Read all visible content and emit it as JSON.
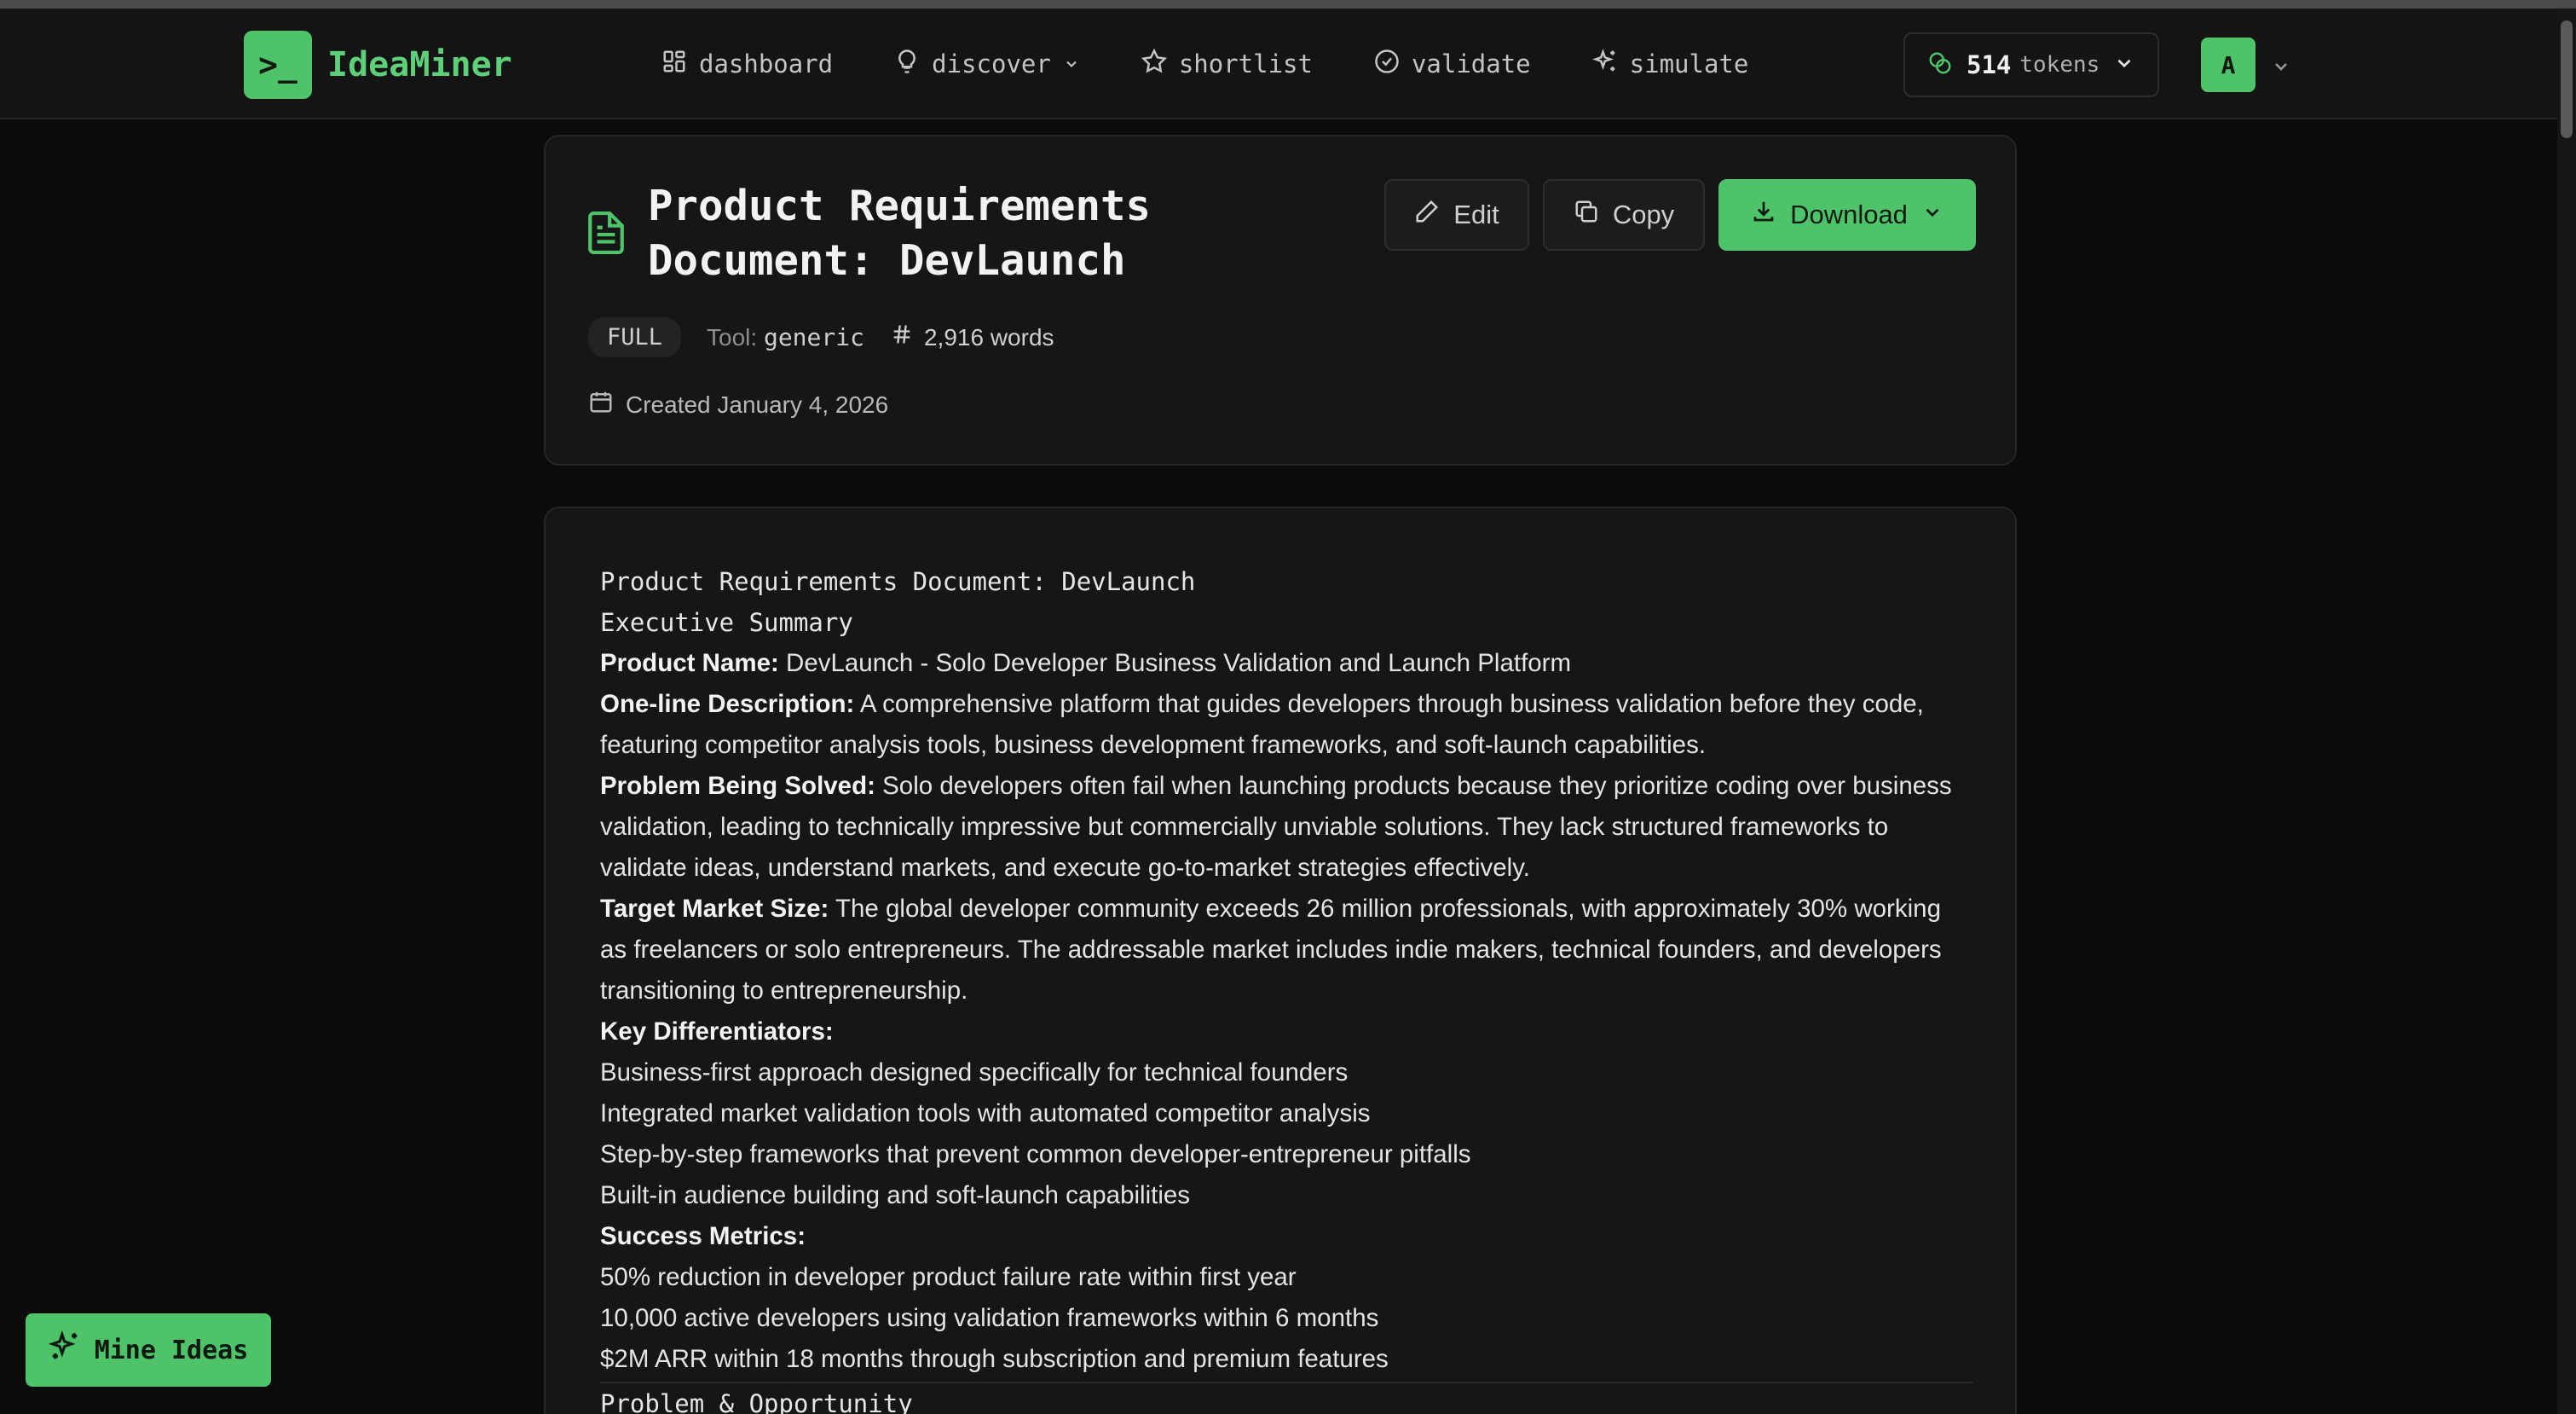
{
  "app": {
    "name": "IdeaMiner",
    "logo_glyph": ">_",
    "accent": "#4fc36a"
  },
  "nav": {
    "items": [
      {
        "label": "dashboard",
        "icon": "grid-icon"
      },
      {
        "label": "discover",
        "icon": "lightbulb-icon",
        "dropdown": true
      },
      {
        "label": "shortlist",
        "icon": "star-icon"
      },
      {
        "label": "validate",
        "icon": "check-circle-icon"
      },
      {
        "label": "simulate",
        "icon": "sparkles-icon"
      }
    ]
  },
  "tokens": {
    "count": "514",
    "label": "tokens"
  },
  "user": {
    "avatar_initial": "A"
  },
  "document": {
    "title": "Product Requirements Document: DevLaunch",
    "badge": "FULL",
    "tool_label": "Tool:",
    "tool_value": "generic",
    "words": "2,916 words",
    "created": "Created January 4, 2026",
    "actions": {
      "edit": "Edit",
      "copy": "Copy",
      "download": "Download"
    }
  },
  "content": {
    "heading": "Product Requirements Document: DevLaunch",
    "section": "Executive Summary",
    "product_name_label": "Product Name:",
    "product_name_value": " DevLaunch - Solo Developer Business Validation and Launch Platform",
    "one_line_label": "One-line Description:",
    "one_line_value": " A comprehensive platform that guides developers through business validation before they code, featuring competitor analysis tools, business development frameworks, and soft-launch capabilities.",
    "problem_label": "Problem Being Solved:",
    "problem_value": " Solo developers often fail when launching products because they prioritize coding over business validation, leading to technically impressive but commercially unviable solutions. They lack structured frameworks to validate ideas, understand markets, and execute go-to-market strategies effectively.",
    "market_label": "Target Market Size:",
    "market_value": " The global developer community exceeds 26 million professionals, with approximately 30% working as freelancers or solo entrepreneurs. The addressable market includes indie makers, technical founders, and developers transitioning to entrepreneurship.",
    "differentiators_label": "Key Differentiators:",
    "differentiators": [
      "Business-first approach designed specifically for technical founders",
      "Integrated market validation tools with automated competitor analysis",
      "Step-by-step frameworks that prevent common developer-entrepreneur pitfalls",
      "Built-in audience building and soft-launch capabilities"
    ],
    "metrics_label": "Success Metrics:",
    "metrics": [
      "50% reduction in developer product failure rate within first year",
      "10,000 active developers using validation frameworks within 6 months",
      "$2M ARR within 18 months through subscription and premium features"
    ],
    "next_section": "Problem & Opportunity"
  },
  "floating": {
    "mine_label": "Mine Ideas"
  }
}
